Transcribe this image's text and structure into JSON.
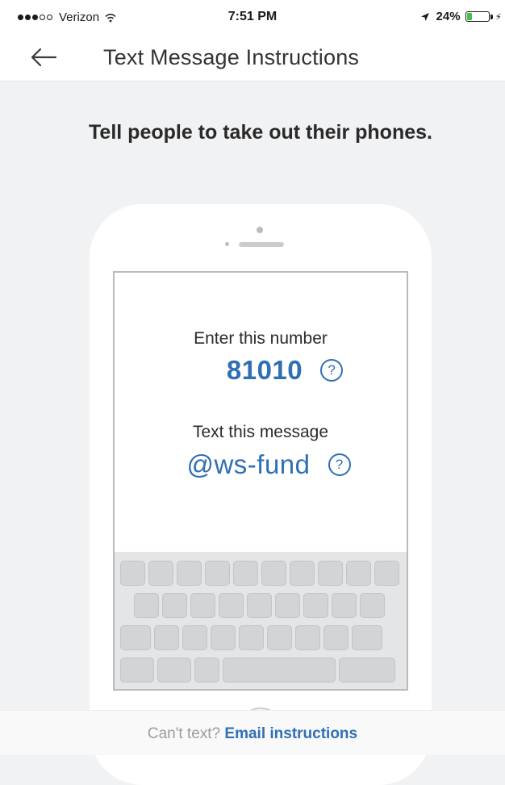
{
  "status_bar": {
    "carrier": "Verizon",
    "time": "7:51 PM",
    "battery_percent": "24%",
    "battery_level": 0.24,
    "signal_bars_filled": 3,
    "signal_bars_total": 5,
    "icons": [
      "wifi-icon",
      "location-icon",
      "battery-icon",
      "charging-icon"
    ]
  },
  "nav": {
    "title": "Text Message Instructions",
    "back_icon": "arrow-left-icon"
  },
  "headline": "Tell people to take out their phones.",
  "phone": {
    "number_label": "Enter this number",
    "number_value": "81010",
    "message_label": "Text this message",
    "message_value": "@ws-fund",
    "help_icon": "question-circle-icon",
    "help_glyph": "?"
  },
  "footer": {
    "prompt": "Can't text?",
    "link": "Email instructions"
  },
  "colors": {
    "accent": "#2f6fb5",
    "background": "#f1f2f4",
    "battery": "#43c24b"
  }
}
